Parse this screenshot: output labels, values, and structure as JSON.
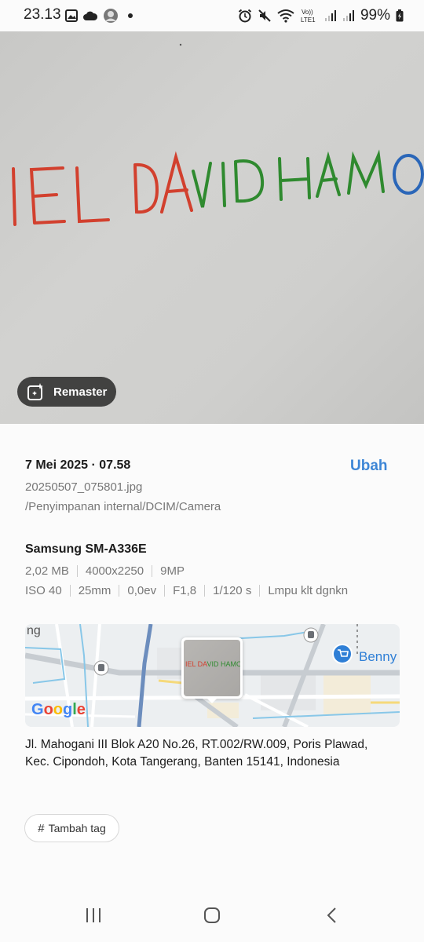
{
  "status_bar": {
    "time": "23.13",
    "battery": "99%",
    "icons": [
      "gallery-notification-icon",
      "cloud-icon",
      "avatar-notification-icon",
      "more-dot",
      "alarm-icon",
      "mute-icon",
      "wifi-icon",
      "volte-icon",
      "signal-icon",
      "signal-icon-2",
      "battery-charging-icon"
    ],
    "network_label": "Vo)) LTE1"
  },
  "photo": {
    "handwriting": {
      "segment_red": "IEL DA",
      "segment_green": "VID HAM",
      "segment_blue": "O",
      "colors": {
        "red": "#d2402e",
        "green": "#2f8a2f",
        "blue": "#2a66b8"
      }
    },
    "remaster_label": "Remaster"
  },
  "details": {
    "date_time": "7 Mei 2025 · 07.58",
    "edit_label": "Ubah",
    "file_name": "20250507_075801.jpg",
    "file_path": "/Penyimpanan internal/DCIM/Camera",
    "device": "Samsung SM-A336E",
    "meta_row_1": [
      "2,02 MB",
      "4000x2250",
      "9MP"
    ],
    "meta_row_2": [
      "ISO 40",
      "25mm",
      "0,0ev",
      "F1,8",
      "1/120 s",
      "Lmpu klt dgnkn"
    ]
  },
  "map": {
    "label_left": "ng",
    "label_place": "Benny",
    "google": [
      "G",
      "o",
      "o",
      "g",
      "l",
      "e"
    ],
    "google_colors": [
      "#4285f4",
      "#ea4335",
      "#fbbc05",
      "#4285f4",
      "#34a853",
      "#ea4335"
    ],
    "thumb_text_red": "IEL DA",
    "thumb_text_green": "VID HAMO"
  },
  "address": "Jl. Mahogani III Blok A20 No.26, RT.002/RW.009, Poris Plawad, Kec. Cipondoh, Kota Tangerang, Banten 15141, Indonesia",
  "tag": {
    "hash": "#",
    "label": "Tambah tag"
  },
  "accent_color": "#3d86d6"
}
